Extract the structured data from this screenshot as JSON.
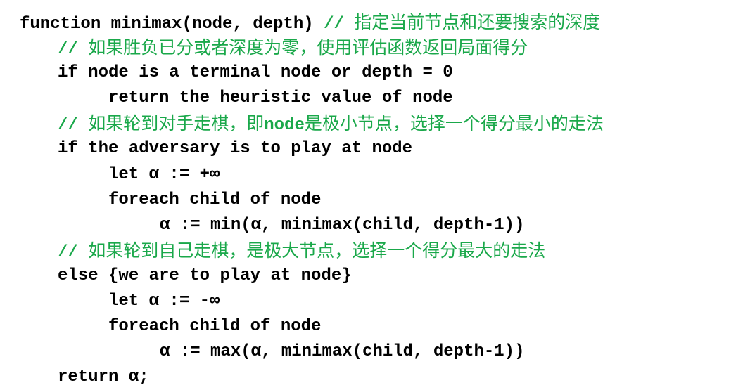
{
  "colors": {
    "code": "#000000",
    "comment": "#1aa84a",
    "background": "#ffffff"
  },
  "lines": [
    {
      "code": "function minimax(node, depth) ",
      "comment_mark": "// ",
      "comment_text": "指定当前节点和还要搜索的深度"
    },
    {
      "comment_mark": "// ",
      "comment_text": "如果胜负已分或者深度为零，使用评估函数返回局面得分"
    },
    {
      "code": "if node is a terminal node or depth = 0"
    },
    {
      "code": "return the heuristic value of node"
    },
    {
      "comment_mark": "// ",
      "comment_text_a": "如果轮到对手走棋，即",
      "comment_code": "node",
      "comment_text_b": "是极小节点，选择一个得分最小的走法"
    },
    {
      "code": "if the adversary is to play at node"
    },
    {
      "code": "let α := +∞"
    },
    {
      "code": "foreach child of node"
    },
    {
      "code": "α := min(α, minimax(child, depth-1))"
    },
    {
      "comment_mark": "// ",
      "comment_text": "如果轮到自己走棋，是极大节点，选择一个得分最大的走法"
    },
    {
      "code": "else {we are to play at node}"
    },
    {
      "code": "let α := -∞"
    },
    {
      "code": "foreach child of node"
    },
    {
      "code": "α := max(α, minimax(child, depth-1))"
    },
    {
      "code": "return α;"
    }
  ]
}
